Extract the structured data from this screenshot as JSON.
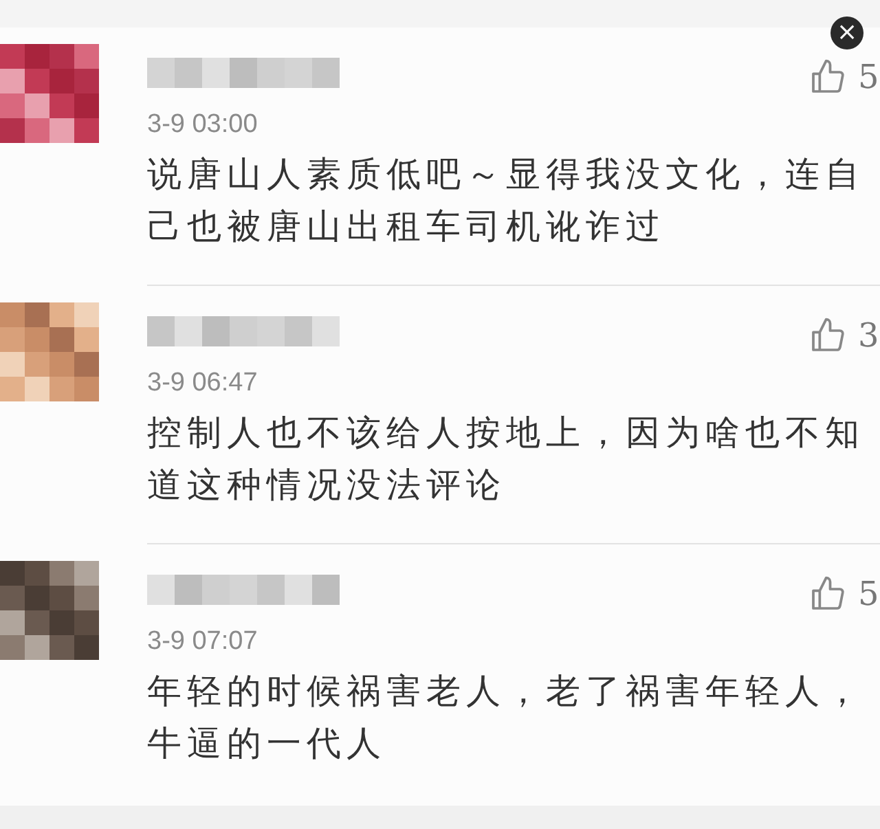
{
  "close_button": {
    "label": "×"
  },
  "comments": [
    {
      "time": "3-9 03:00",
      "likes": "5",
      "text": "说唐山人素质低吧～显得我没文化，连自己也被唐山出租车司机讹诈过"
    },
    {
      "time": "3-9 06:47",
      "likes": "3",
      "text": "控制人也不该给人按地上，因为啥也不知道这种情况没法评论"
    },
    {
      "time": "3-9 07:07",
      "likes": "5",
      "text": "年轻的时候祸害老人，老了祸害年轻人，牛逼的一代人"
    }
  ]
}
